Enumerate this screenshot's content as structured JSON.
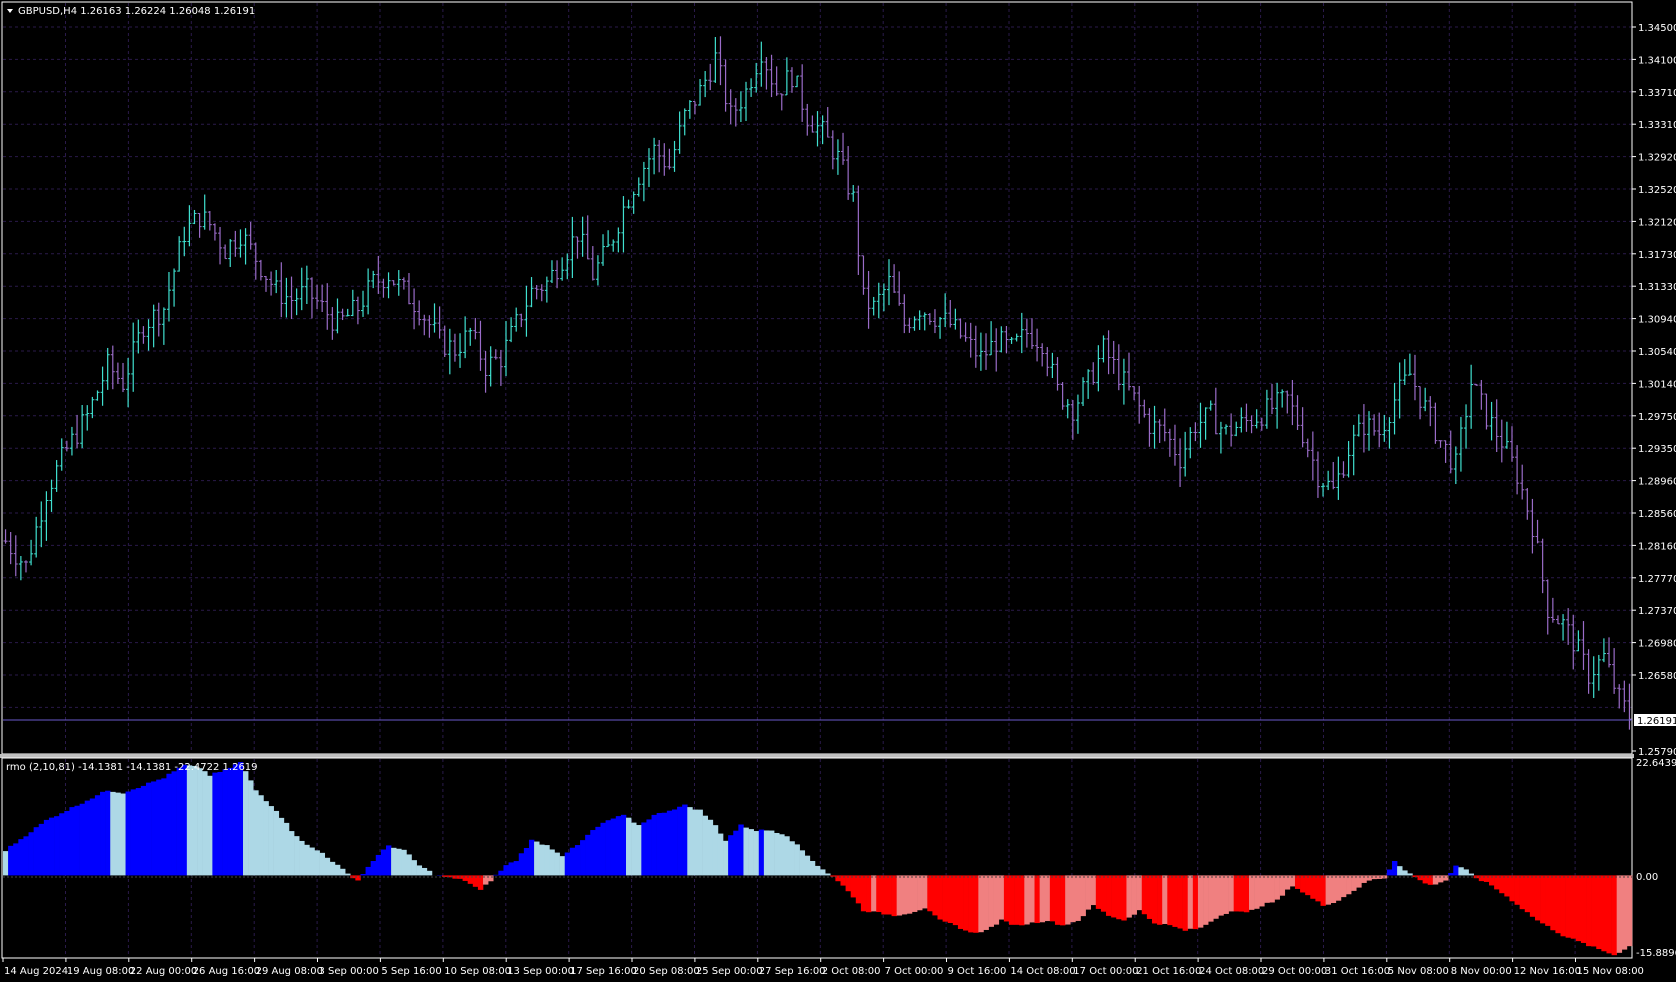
{
  "window": {
    "symbol_header": "GBPUSD,H4  1.26163 1.26224 1.26048 1.26191",
    "indicator_header": "rmo (2,10,81) -14.1381 -14.1381 -22.4722 1.2619"
  },
  "colors": {
    "background": "#000000",
    "grid": "#2a1a4a",
    "bull_candle": "#40e0d0",
    "bear_candle": "#9a6cc8",
    "bid_line": "#6a5acd",
    "rmo_pos_strong": "#0000ff",
    "rmo_pos_weak": "#add8e6",
    "rmo_neg_strong": "#ff0000",
    "rmo_neg_weak": "#f08080"
  },
  "price_axis": {
    "labels": [
      "1.34500",
      "1.34100",
      "1.33710",
      "1.33310",
      "1.32920",
      "1.32520",
      "1.32120",
      "1.31730",
      "1.31330",
      "1.30940",
      "1.30540",
      "1.30140",
      "1.29750",
      "1.29350",
      "1.28960",
      "1.28560",
      "1.28160",
      "1.27770",
      "1.27370",
      "1.26980",
      "1.26580",
      "1.25790"
    ],
    "current_price": "1.26191"
  },
  "indicator_axis": {
    "labels": [
      "22.6439",
      "0.00",
      "-15.8896"
    ]
  },
  "time_axis": {
    "labels": [
      "14 Aug 2024",
      "19 Aug 08:00",
      "22 Aug 00:00",
      "26 Aug 16:00",
      "29 Aug 08:00",
      "3 Sep 00:00",
      "5 Sep 16:00",
      "10 Sep 08:00",
      "13 Sep 00:00",
      "17 Sep 16:00",
      "20 Sep 08:00",
      "25 Sep 00:00",
      "27 Sep 16:00",
      "2 Oct 08:00",
      "7 Oct 00:00",
      "9 Oct 16:00",
      "14 Oct 08:00",
      "17 Oct 00:00",
      "21 Oct 16:00",
      "24 Oct 08:00",
      "29 Oct 00:00",
      "31 Oct 16:00",
      "5 Nov 08:00",
      "8 Nov 00:00",
      "12 Nov 16:00",
      "15 Nov 08:00"
    ]
  },
  "chart_data": [
    {
      "type": "candlestick",
      "title": "GBPUSD,H4",
      "ylim": [
        1.2579,
        1.347
      ],
      "price_path": [
        [
          0,
          1.283
        ],
        [
          4,
          1.28
        ],
        [
          8,
          1.289
        ],
        [
          12,
          1.294
        ],
        [
          16,
          1.298
        ],
        [
          20,
          1.304
        ],
        [
          23,
          1.302
        ],
        [
          27,
          1.309
        ],
        [
          31,
          1.311
        ],
        [
          35,
          1.32
        ],
        [
          38,
          1.322
        ],
        [
          40,
          1.321
        ],
        [
          43,
          1.318
        ],
        [
          46,
          1.32
        ],
        [
          49,
          1.317
        ],
        [
          53,
          1.313
        ],
        [
          56,
          1.312
        ],
        [
          59,
          1.313
        ],
        [
          62,
          1.311
        ],
        [
          65,
          1.309
        ],
        [
          69,
          1.311
        ],
        [
          72,
          1.314
        ],
        [
          75,
          1.315
        ],
        [
          78,
          1.313
        ],
        [
          81,
          1.311
        ],
        [
          85,
          1.307
        ],
        [
          88,
          1.306
        ],
        [
          91,
          1.308
        ],
        [
          94,
          1.304
        ],
        [
          97,
          1.305
        ],
        [
          100,
          1.309
        ],
        [
          103,
          1.313
        ],
        [
          106,
          1.314
        ],
        [
          109,
          1.317
        ],
        [
          112,
          1.32
        ],
        [
          115,
          1.315
        ],
        [
          118,
          1.318
        ],
        [
          121,
          1.323
        ],
        [
          124,
          1.327
        ],
        [
          127,
          1.33
        ],
        [
          130,
          1.328
        ],
        [
          133,
          1.334
        ],
        [
          136,
          1.337
        ],
        [
          139,
          1.341
        ],
        [
          142,
          1.334
        ],
        [
          145,
          1.337
        ],
        [
          148,
          1.342
        ],
        [
          151,
          1.337
        ],
        [
          154,
          1.339
        ],
        [
          157,
          1.334
        ],
        [
          160,
          1.332
        ],
        [
          163,
          1.329
        ],
        [
          166,
          1.324
        ],
        [
          168,
          1.312
        ],
        [
          170,
          1.311
        ],
        [
          173,
          1.314
        ],
        [
          176,
          1.309
        ],
        [
          179,
          1.311
        ],
        [
          182,
          1.31
        ],
        [
          185,
          1.309
        ],
        [
          188,
          1.307
        ],
        [
          191,
          1.305
        ],
        [
          194,
          1.307
        ],
        [
          197,
          1.306
        ],
        [
          200,
          1.308
        ],
        [
          203,
          1.307
        ],
        [
          206,
          1.301
        ],
        [
          209,
          1.299
        ],
        [
          212,
          1.302
        ],
        [
          215,
          1.306
        ],
        [
          218,
          1.303
        ],
        [
          221,
          1.3
        ],
        [
          224,
          1.297
        ],
        [
          227,
          1.296
        ],
        [
          230,
          1.293
        ],
        [
          233,
          1.297
        ],
        [
          236,
          1.298
        ],
        [
          239,
          1.296
        ],
        [
          242,
          1.297
        ],
        [
          245,
          1.298
        ],
        [
          248,
          1.299
        ],
        [
          251,
          1.3
        ],
        [
          254,
          1.296
        ],
        [
          257,
          1.291
        ],
        [
          260,
          1.289
        ],
        [
          263,
          1.294
        ],
        [
          266,
          1.297
        ],
        [
          269,
          1.296
        ],
        [
          272,
          1.3
        ],
        [
          275,
          1.303
        ],
        [
          278,
          1.299
        ],
        [
          281,
          1.295
        ],
        [
          284,
          1.292
        ],
        [
          287,
          1.302
        ],
        [
          290,
          1.298
        ],
        [
          293,
          1.295
        ],
        [
          296,
          1.291
        ],
        [
          299,
          1.285
        ],
        [
          302,
          1.275
        ],
        [
          305,
          1.273
        ],
        [
          307,
          1.271
        ],
        [
          310,
          1.267
        ],
        [
          313,
          1.269
        ],
        [
          316,
          1.264
        ],
        [
          318,
          1.262
        ]
      ]
    },
    {
      "type": "histogram",
      "title": "rmo (2,10,81)",
      "ylim": [
        -15.8896,
        22.6439
      ],
      "value_path": [
        [
          0,
          5
        ],
        [
          4,
          8
        ],
        [
          8,
          11
        ],
        [
          12,
          13
        ],
        [
          16,
          15
        ],
        [
          20,
          17
        ],
        [
          23,
          16.5
        ],
        [
          27,
          18
        ],
        [
          31,
          19.5
        ],
        [
          35,
          22
        ],
        [
          38,
          21.5
        ],
        [
          40,
          20
        ],
        [
          43,
          21
        ],
        [
          46,
          22.6
        ],
        [
          49,
          17
        ],
        [
          53,
          13
        ],
        [
          56,
          9
        ],
        [
          59,
          6
        ],
        [
          62,
          4.5
        ],
        [
          65,
          2
        ],
        [
          67,
          0.3
        ],
        [
          69,
          -1
        ],
        [
          72,
          3
        ],
        [
          75,
          6
        ],
        [
          78,
          5
        ],
        [
          81,
          2
        ],
        [
          84,
          0.2
        ],
        [
          87,
          -0.5
        ],
        [
          90,
          -1
        ],
        [
          93,
          -3
        ],
        [
          95,
          -1
        ],
        [
          98,
          2
        ],
        [
          100,
          3
        ],
        [
          103,
          7
        ],
        [
          106,
          6
        ],
        [
          109,
          4
        ],
        [
          112,
          6
        ],
        [
          115,
          9
        ],
        [
          118,
          11
        ],
        [
          121,
          12
        ],
        [
          124,
          10
        ],
        [
          127,
          12
        ],
        [
          130,
          13
        ],
        [
          133,
          14
        ],
        [
          136,
          13
        ],
        [
          139,
          10
        ],
        [
          141,
          7
        ],
        [
          144,
          10
        ],
        [
          147,
          9
        ],
        [
          150,
          9
        ],
        [
          153,
          8
        ],
        [
          156,
          5
        ],
        [
          159,
          2
        ],
        [
          162,
          -0.3
        ],
        [
          165,
          -3
        ],
        [
          168,
          -7
        ],
        [
          171,
          -7.5
        ],
        [
          174,
          -8
        ],
        [
          177,
          -7.5
        ],
        [
          180,
          -6.5
        ],
        [
          183,
          -9
        ],
        [
          186,
          -10
        ],
        [
          189,
          -11.5
        ],
        [
          192,
          -11
        ],
        [
          195,
          -9
        ],
        [
          198,
          -10
        ],
        [
          201,
          -9.5
        ],
        [
          204,
          -9
        ],
        [
          207,
          -10
        ],
        [
          210,
          -9
        ],
        [
          213,
          -6
        ],
        [
          216,
          -8
        ],
        [
          219,
          -9
        ],
        [
          222,
          -7
        ],
        [
          225,
          -9.5
        ],
        [
          228,
          -10
        ],
        [
          231,
          -11
        ],
        [
          234,
          -10.5
        ],
        [
          237,
          -8.5
        ],
        [
          240,
          -7
        ],
        [
          243,
          -7.5
        ],
        [
          246,
          -6
        ],
        [
          249,
          -5
        ],
        [
          252,
          -2
        ],
        [
          255,
          -4
        ],
        [
          258,
          -6
        ],
        [
          261,
          -5
        ],
        [
          264,
          -3
        ],
        [
          267,
          -1
        ],
        [
          270,
          -0.5
        ],
        [
          272,
          3
        ],
        [
          274,
          1
        ],
        [
          277,
          -1
        ],
        [
          279,
          -2
        ],
        [
          282,
          -1
        ],
        [
          284,
          2
        ],
        [
          286,
          1
        ],
        [
          288,
          -0.5
        ],
        [
          291,
          -2
        ],
        [
          295,
          -5
        ],
        [
          300,
          -9
        ],
        [
          305,
          -12
        ],
        [
          310,
          -14
        ],
        [
          315,
          -15.8896
        ],
        [
          318,
          -14.1381
        ]
      ]
    }
  ]
}
